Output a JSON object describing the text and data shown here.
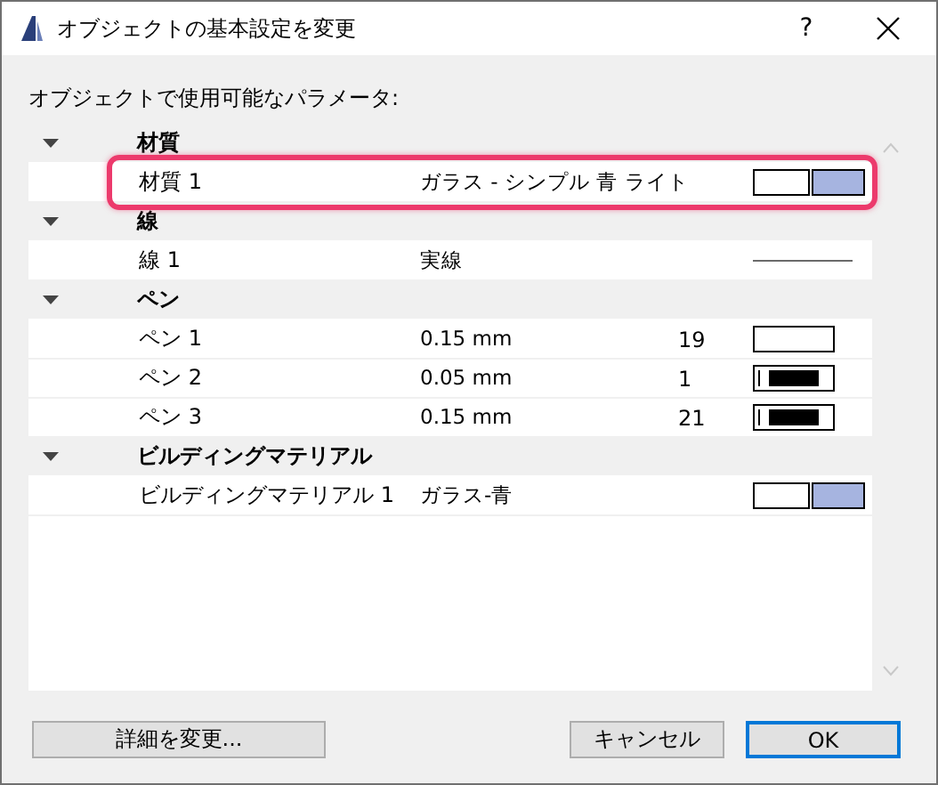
{
  "window": {
    "title": "オブジェクトの基本設定を変更",
    "help": "?"
  },
  "list_label": "オブジェクトで使用可能なパラメータ:",
  "groups": [
    {
      "name": "材質",
      "expanded": true,
      "children": [
        {
          "name": "材質 1",
          "value": "ガラス - シンプル 青 ライト",
          "highlighted": true,
          "swatch": {
            "kind": "colors",
            "colors": [
              {
                "color": "#ffffff"
              },
              {
                "color": "#a6b4e0"
              }
            ]
          }
        }
      ]
    },
    {
      "name": "線",
      "expanded": true,
      "children": [
        {
          "name": "線 1",
          "value": "実線",
          "swatch": {
            "kind": "line"
          }
        }
      ]
    },
    {
      "name": "ペン",
      "expanded": true,
      "children": [
        {
          "name": "ペン 1",
          "value": "0.15 mm",
          "number": "19",
          "swatch": {
            "kind": "pen",
            "filled": false
          }
        },
        {
          "name": "ペン 2",
          "value": "0.05 mm",
          "number": "1",
          "swatch": {
            "kind": "pen",
            "filled": true
          }
        },
        {
          "name": "ペン 3",
          "value": "0.15 mm",
          "number": "21",
          "swatch": {
            "kind": "pen",
            "filled": true
          }
        }
      ]
    },
    {
      "name": "ビルディングマテリアル",
      "expanded": true,
      "children": [
        {
          "name": "ビルディングマテリアル 1",
          "value": "ガラス-青",
          "swatch": {
            "kind": "colors",
            "colors": [
              {
                "color": "#ffffff"
              },
              {
                "color": "#a6b4e0"
              }
            ]
          }
        }
      ]
    }
  ],
  "buttons": [
    {
      "label": "詳細を変更...",
      "default": false
    },
    {
      "label": "キャンセル",
      "default": false
    },
    {
      "label": "OK",
      "default": true
    }
  ]
}
